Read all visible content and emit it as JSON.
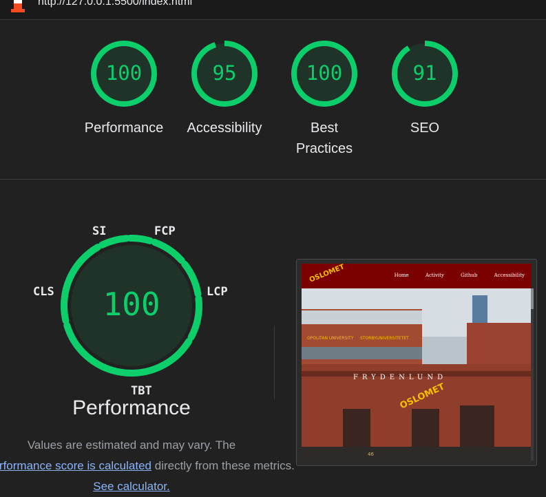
{
  "browser": {
    "url": "http://127.0.0.1:5500/index.html"
  },
  "colors": {
    "pass": "#0cce6b",
    "pass_bg": "#1f3329",
    "link": "#8ab4f8",
    "nav": "#7b0000"
  },
  "scores": [
    {
      "label": "Performance",
      "score": "100",
      "fraction": 1.0
    },
    {
      "label": "Accessibility",
      "score": "95",
      "fraction": 0.95
    },
    {
      "label": "Best Practices",
      "score": "100",
      "fraction": 1.0
    },
    {
      "label": "SEO",
      "score": "91",
      "fraction": 0.91
    }
  ],
  "performance": {
    "score": "100",
    "title": "Performance",
    "metrics": {
      "si": "SI",
      "fcp": "FCP",
      "lcp": "LCP",
      "tbt": "TBT",
      "cls": "CLS"
    },
    "desc_part1": "Values are estimated and may vary. The ",
    "desc_link1": "performance score is calculated",
    "desc_part2": " directly from these metrics. ",
    "desc_link2": "See calculator."
  },
  "screenshot": {
    "logo": "OSLOMET",
    "nav": [
      "Home",
      "Activity",
      "Github",
      "Accessibility"
    ],
    "building_sign": "FRYDENLUND",
    "facade_sign_left": "OPOLITAN UNIVERSITY",
    "facade_sign_right": "STORBYUNIVERSITETET",
    "door_number": "46"
  }
}
